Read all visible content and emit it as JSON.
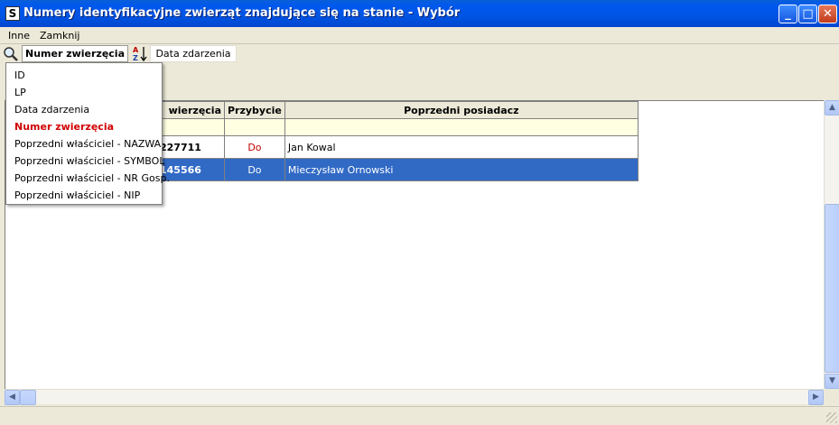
{
  "window": {
    "title": "Numery identyfikacyjne zwierząt znajdujące się na stanie  - Wybór",
    "app_icon": "S",
    "minimize_label": "_",
    "maximize_label": "□",
    "close_label": "✕"
  },
  "menu": {
    "items": [
      {
        "label": "Inne"
      },
      {
        "label": "Zamknij"
      }
    ]
  },
  "toolbar": {
    "sort_field_label": "Numer zwierzęcia",
    "date_field_label": "Data zdarzenia",
    "sort_icon_top": "A",
    "sort_icon_bottom": "Z"
  },
  "dropdown": {
    "items": [
      {
        "label": "ID",
        "active": false
      },
      {
        "label": "LP",
        "active": false
      },
      {
        "label": "Data zdarzenia",
        "active": false
      },
      {
        "label": "Numer zwierzęcia",
        "active": true
      },
      {
        "label": "Poprzedni właściciel - NAZWA",
        "active": false
      },
      {
        "label": "Poprzedni właściciel - SYMBOL",
        "active": false
      },
      {
        "label": "Poprzedni właściciel - NR Gosp.",
        "active": false
      },
      {
        "label": "Poprzedni właściciel - NIP",
        "active": false
      }
    ]
  },
  "grid": {
    "columns": [
      "wierzęcia",
      "Przybycie",
      "Poprzedni posiadacz"
    ],
    "rows": [
      {
        "number": "227711",
        "arrival": "Do",
        "owner": "Jan Kowal",
        "selected": false
      },
      {
        "number": "145566",
        "arrival": "Do",
        "owner": "Mieczysław Ornowski",
        "selected": true
      }
    ]
  },
  "colors": {
    "accent": "#316ac5",
    "active_item": "#d00000",
    "filter_row": "#ffffe1"
  }
}
